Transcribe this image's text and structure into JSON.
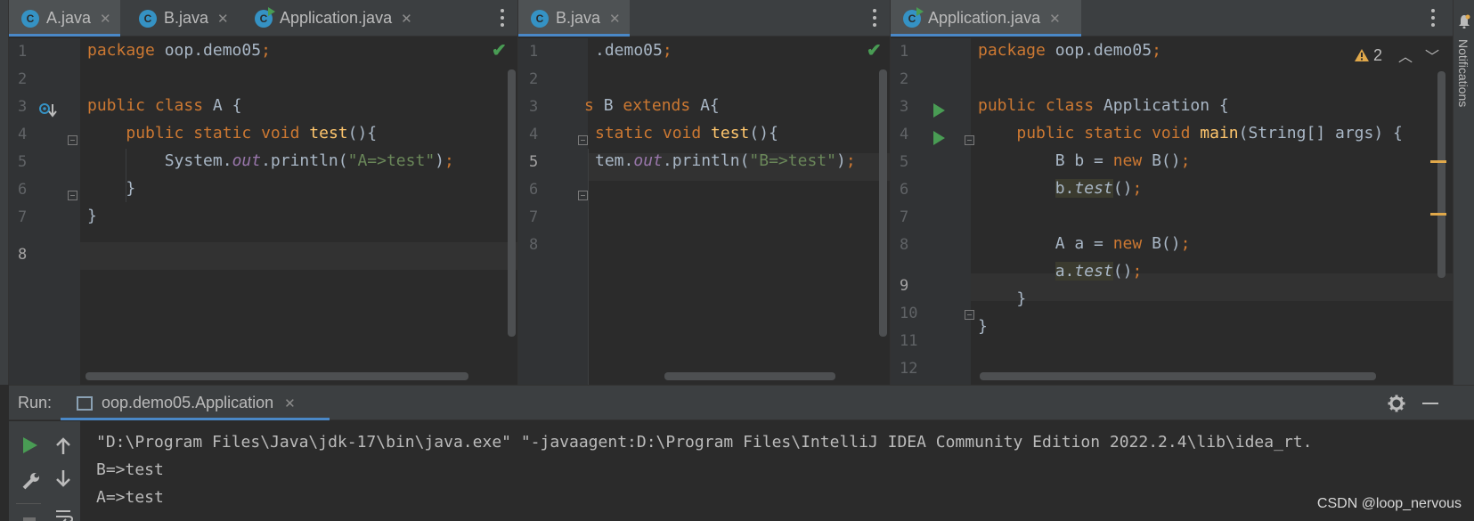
{
  "editors": [
    {
      "tabs": [
        {
          "label": "A.java",
          "icon": "class-icon",
          "active": true
        },
        {
          "label": "B.java",
          "icon": "class-icon",
          "active": false
        },
        {
          "label": "Application.java",
          "icon": "app-class-icon",
          "active": false
        }
      ],
      "line_numbers": [
        "1",
        "2",
        "3",
        "4",
        "5",
        "6",
        "7",
        "8"
      ],
      "lines": [
        "package oop.demo05;",
        "",
        "public class A {",
        "    public static void test(){",
        "        System.out.println(\"A=>test\");",
        "    }",
        "}",
        ""
      ]
    },
    {
      "tabs": [
        {
          "label": "B.java",
          "icon": "class-icon",
          "active": true
        }
      ],
      "line_numbers": [
        "1",
        "2",
        "3",
        "4",
        "5",
        "6",
        "7",
        "8"
      ],
      "lines": [
        ".demo05;",
        "",
        "s B extends A{",
        "static void test(){",
        "tem.out.println(\"B=>test\");",
        "",
        "",
        ""
      ]
    },
    {
      "tabs": [
        {
          "label": "Application.java",
          "icon": "app-class-icon",
          "active": true
        }
      ],
      "warning_count": "2",
      "line_numbers": [
        "1",
        "2",
        "3",
        "4",
        "5",
        "6",
        "7",
        "8",
        "9",
        "10",
        "11",
        "12"
      ],
      "lines": [
        "package oop.demo05;",
        "",
        "public class Application {",
        "    public static void main(String[] args) {",
        "        B b = new B();",
        "        b.test();",
        "",
        "        A a = new B();",
        "        a.test();",
        "    }",
        "}",
        ""
      ]
    }
  ],
  "side_panel": {
    "notifications_label": "Notifications"
  },
  "run_panel": {
    "label": "Run:",
    "tab_label": "oop.demo05.Application",
    "console_lines": [
      "\"D:\\Program Files\\Java\\jdk-17\\bin\\java.exe\" \"-javaagent:D:\\Program Files\\IntelliJ IDEA Community Edition 2022.2.4\\lib\\idea_rt.",
      "B=>test",
      "A=>test"
    ]
  },
  "watermark": "CSDN @loop_nervous",
  "colors": {
    "keyword": "#cc7832",
    "function": "#ffc66d",
    "string": "#6a8759",
    "field": "#9876aa",
    "accent": "#4a88c7",
    "run_green": "#499c54"
  }
}
